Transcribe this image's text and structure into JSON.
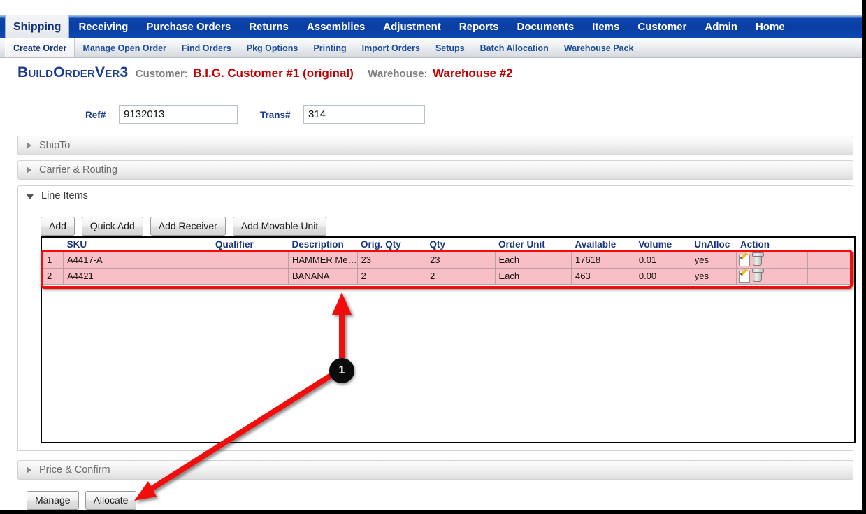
{
  "mainnav": {
    "items": [
      {
        "label": "Shipping",
        "active": true
      },
      {
        "label": "Receiving",
        "active": false
      },
      {
        "label": "Purchase Orders",
        "active": false
      },
      {
        "label": "Returns",
        "active": false
      },
      {
        "label": "Assemblies",
        "active": false
      },
      {
        "label": "Adjustment",
        "active": false
      },
      {
        "label": "Reports",
        "active": false
      },
      {
        "label": "Documents",
        "active": false
      },
      {
        "label": "Items",
        "active": false
      },
      {
        "label": "Customer",
        "active": false
      },
      {
        "label": "Admin",
        "active": false
      },
      {
        "label": "Home",
        "active": false
      }
    ]
  },
  "subnav": {
    "items": [
      {
        "label": "Create Order",
        "active": true
      },
      {
        "label": "Manage Open Order",
        "active": false
      },
      {
        "label": "Find Orders",
        "active": false
      },
      {
        "label": "Pkg Options",
        "active": false
      },
      {
        "label": "Printing",
        "active": false
      },
      {
        "label": "Import Orders",
        "active": false
      },
      {
        "label": "Setups",
        "active": false
      },
      {
        "label": "Batch Allocation",
        "active": false
      },
      {
        "label": "Warehouse Pack",
        "active": false
      }
    ]
  },
  "pagehead": {
    "brand": "BuildOrderVer3",
    "customer_label": "Customer:",
    "customer_value": "B.I.G. Customer #1 (original)",
    "warehouse_label": "Warehouse:",
    "warehouse_value": "Warehouse #2"
  },
  "fields": {
    "ref_label": "Ref#",
    "ref_value": "9132013",
    "trans_label": "Trans#",
    "trans_value": "314"
  },
  "sections": {
    "shipto": "ShipTo",
    "carrier": "Carrier & Routing",
    "lineitems": "Line Items",
    "price": "Price & Confirm"
  },
  "lineitem_buttons": [
    {
      "label": "Add"
    },
    {
      "label": "Quick Add"
    },
    {
      "label": "Add Receiver"
    },
    {
      "label": "Add Movable Unit"
    }
  ],
  "grid": {
    "columns": [
      "",
      "SKU",
      "Qualifier",
      "Description",
      "Orig. Qty",
      "Qty",
      "Order Unit",
      "Available",
      "Volume",
      "UnAlloc",
      "Action",
      ""
    ],
    "rows": [
      {
        "index": "1",
        "sku": "A4417-A",
        "qualifier": "",
        "description": "HAMMER Mediu...",
        "orig_qty": "23",
        "qty": "23",
        "order_unit": "Each",
        "available": "17618",
        "volume": "0.01",
        "unalloc": "yes"
      },
      {
        "index": "2",
        "sku": "A4421",
        "qualifier": "",
        "description": "BANANA",
        "orig_qty": "2",
        "qty": "2",
        "order_unit": "Each",
        "available": "463",
        "volume": "0.00",
        "unalloc": "yes"
      }
    ],
    "row_action_icons": [
      "edit-icon",
      "delete-icon"
    ]
  },
  "footer_buttons": [
    {
      "label": "Manage"
    },
    {
      "label": "Allocate"
    }
  ],
  "annotation": {
    "badge": "1",
    "color": "#f20d0d"
  }
}
